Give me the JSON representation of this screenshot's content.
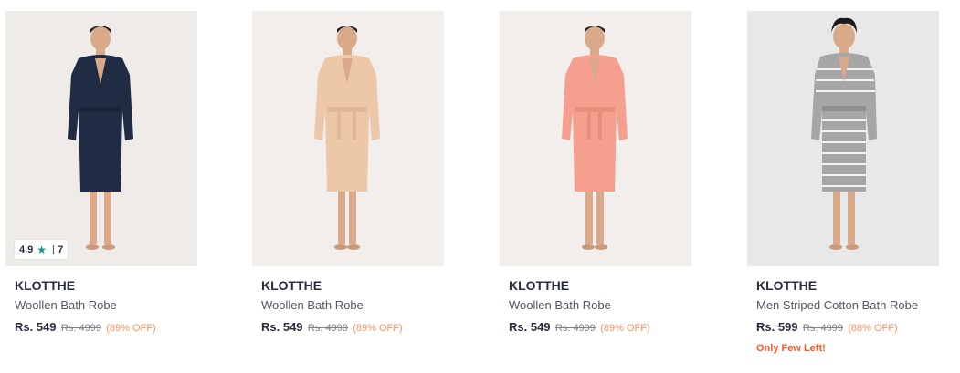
{
  "products": [
    {
      "brand": "KLOTTHE",
      "title": "Woollen Bath Robe",
      "price": "Rs. 549",
      "mrp": "Rs. 4999",
      "discount": "(89% OFF)",
      "rating": "4.9",
      "rating_count": "7",
      "robe_color": "#1f2c44",
      "bg_color": "#efebe9"
    },
    {
      "brand": "KLOTTHE",
      "title": "Woollen Bath Robe",
      "price": "Rs. 549",
      "mrp": "Rs. 4999",
      "discount": "(89% OFF)",
      "robe_color": "#ecc8a8",
      "bg_color": "#f2eeeb"
    },
    {
      "brand": "KLOTTHE",
      "title": "Woollen Bath Robe",
      "price": "Rs. 549",
      "mrp": "Rs. 4999",
      "discount": "(89% OFF)",
      "robe_color": "#f5a08e",
      "bg_color": "#f2eeeb"
    },
    {
      "brand": "KLOTTHE",
      "title": "Men Striped Cotton Bath Robe",
      "price": "Rs. 599",
      "mrp": "Rs. 4999",
      "discount": "(88% OFF)",
      "stock_note": "Only Few Left!",
      "robe_color": "#a6a6a6",
      "bg_color": "#e8e8e8"
    }
  ],
  "colors": {
    "rating_star": "#14958f",
    "discount": "#ff905a",
    "stock_warning": "#ff5722",
    "brand_text": "#282c3f"
  },
  "icons": {
    "rating": "star-icon"
  }
}
